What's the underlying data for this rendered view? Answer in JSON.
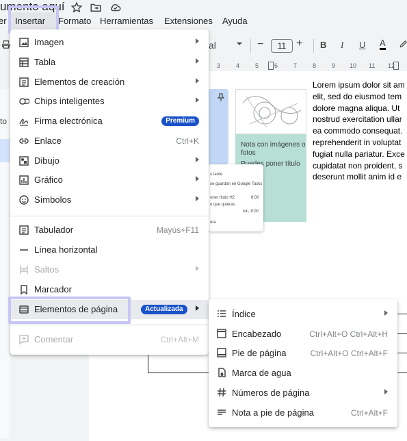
{
  "document": {
    "title": "umento aquí"
  },
  "menubar": {
    "items": [
      {
        "label": "er"
      },
      {
        "label": "Insertar"
      },
      {
        "label": "Formato"
      },
      {
        "label": "Herramientas"
      },
      {
        "label": "Extensiones"
      },
      {
        "label": "Ayuda"
      }
    ]
  },
  "toolbar": {
    "font_name": "al",
    "font_size": "11",
    "minus": "−",
    "plus": "+",
    "bold": "B",
    "italic": "I",
    "underline": "U",
    "text_color": "A"
  },
  "ruler": {
    "ticks": [
      "3",
      "4",
      "5",
      "6",
      "7",
      "8",
      "9",
      "10",
      "11",
      "12"
    ]
  },
  "outline": {
    "partial_label": "to"
  },
  "body_text": {
    "lines": [
      "Lorem ipsum dolor sit am",
      "elit, sed do eiusmod tem",
      "dolore magna aliqua. Ut",
      "nostrud exercitation ullar",
      "ea commodo consequat.",
      "reprehenderit in voluptat",
      "fugiat nulla pariatur. Exce",
      "cupidatat non proident, s",
      "deserunt mollit anim id e"
    ]
  },
  "cards": {
    "green_lines": [
      "Nota con imágenes o",
      "fotos",
      "Puedes poner  título"
    ],
    "white_lines": [
      "s tarde",
      "se guardan en Google Tasks",
      "oner título H2",
      "o que quieras",
      "8:00",
      "lun, 8:00",
      "ora"
    ]
  },
  "insert_menu": {
    "items": [
      {
        "label": "Imagen",
        "icon": "image-icon",
        "arrow": true
      },
      {
        "label": "Tabla",
        "icon": "table-icon",
        "arrow": true
      },
      {
        "label": "Elementos de creación",
        "icon": "building-blocks-icon",
        "arrow": true
      },
      {
        "label": "Chips inteligentes",
        "icon": "smart-chip-icon",
        "arrow": true
      },
      {
        "label": "Firma electrónica",
        "icon": "signature-icon",
        "badge": "Premium"
      },
      {
        "label": "Enlace",
        "icon": "link-icon",
        "shortcut": "Ctrl+K"
      },
      {
        "label": "Dibujo",
        "icon": "drawing-icon",
        "arrow": true
      },
      {
        "label": "Gráfico",
        "icon": "chart-icon",
        "arrow": true
      },
      {
        "label": "Símbolos",
        "icon": "emoji-icon",
        "arrow": true
      },
      {
        "label": "Tabulador",
        "icon": "tab-icon",
        "shortcut": "Mayús+F11"
      },
      {
        "label": "Línea horizontal",
        "icon": "horizontal-line-icon"
      },
      {
        "label": "Saltos",
        "icon": "break-icon",
        "arrow": true,
        "disabled": true
      },
      {
        "label": "Marcador",
        "icon": "bookmark-icon"
      },
      {
        "label": "Elementos de página",
        "icon": "page-elements-icon",
        "badge": "Actualizada",
        "arrow": true,
        "active": true
      },
      {
        "label": "Comentar",
        "icon": "comment-icon",
        "shortcut": "Ctrl+Alt+M",
        "disabled": true
      }
    ]
  },
  "page_elements_submenu": {
    "items": [
      {
        "label": "Índice",
        "icon": "table-of-contents-icon",
        "arrow": true
      },
      {
        "label": "Encabezado",
        "icon": "header-icon",
        "shortcut": "Ctrl+Alt+O Ctrl+Alt+H"
      },
      {
        "label": "Pie de página",
        "icon": "footer-icon",
        "shortcut": "Ctrl+Alt+O Ctrl+Alt+F"
      },
      {
        "label": "Marca de agua",
        "icon": "watermark-icon"
      },
      {
        "label": "Números de página",
        "icon": "page-number-icon",
        "arrow": true
      },
      {
        "label": "Nota a pie de página",
        "icon": "footnote-icon",
        "shortcut": "Ctrl+Alt+F"
      }
    ]
  },
  "colors": {
    "highlight": "#c8c6f5",
    "badge": "#1a52c9",
    "card_green": "#b7dfd5",
    "card_blue": "#c2d7f5"
  }
}
